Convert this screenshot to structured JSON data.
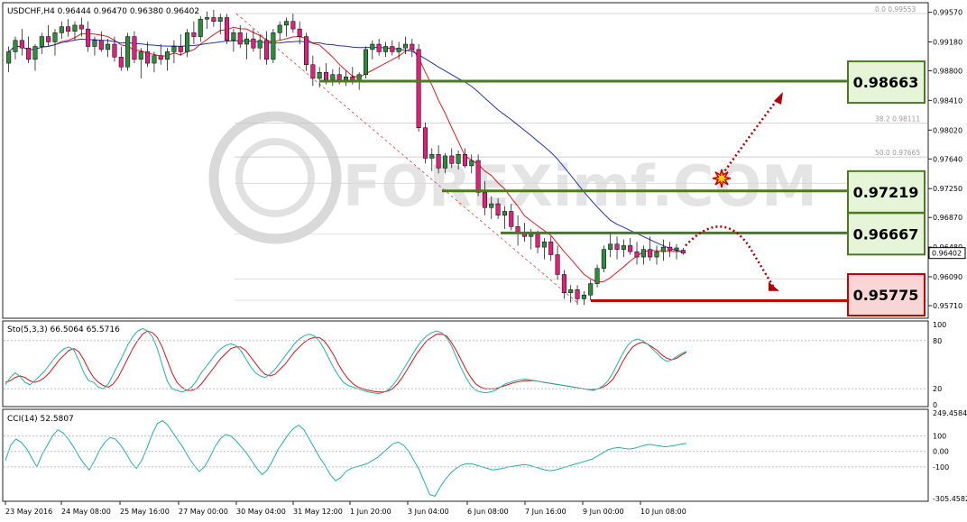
{
  "window": {
    "symbol_info": "USDCHF,H4  0.96444 0.96470 0.96380 0.96402"
  },
  "colors": {
    "bull": "#2e8b3a",
    "bear": "#e0207a",
    "ma_fast": "#e31c1c",
    "ma_slow": "#2233bb",
    "level_green": "#4a7c1f",
    "level_red": "#cc0000",
    "stoch_main": "#20b2aa",
    "stoch_signal": "#dd1111",
    "cci": "#20b2aa",
    "badge_green_bg": "#e6f4d7",
    "badge_red_bg": "#f9d6d6",
    "fib_text": "#9a9a9a"
  },
  "price_axis": {
    "ticks": [
      "0.99570",
      "0.99180",
      "0.98800",
      "0.98410",
      "0.98020",
      "0.97640",
      "0.97250",
      "0.96870",
      "0.96480",
      "0.96090",
      "0.95710"
    ],
    "current": "0.96402"
  },
  "fib_labels": [
    {
      "text": "0.0  0.99553",
      "price": 0.99553
    },
    {
      "text": "38.2  0.98111",
      "price": 0.98111
    },
    {
      "text": "50.0  0.97665",
      "price": 0.97665
    }
  ],
  "levels": [
    {
      "label": "0.98663",
      "price": 0.98663,
      "kind": "resistance"
    },
    {
      "label": "0.97219",
      "price": 0.97219,
      "kind": "resistance"
    },
    {
      "label": "0.96667",
      "price": 0.96667,
      "kind": "resistance"
    },
    {
      "label": "0.95775",
      "price": 0.95775,
      "kind": "support"
    }
  ],
  "watermark": "FOREXimf.COM",
  "stochastic": {
    "label": "Sto(5,3,3) 66.5064 65.5716",
    "ticks": [
      "100",
      "80",
      "20",
      "0"
    ],
    "main": [
      25,
      34,
      40,
      35,
      28,
      25,
      30,
      36,
      42,
      50,
      58,
      65,
      70,
      72,
      68,
      55,
      40,
      30,
      28,
      22,
      20,
      26,
      38,
      50,
      62,
      75,
      85,
      92,
      95,
      92,
      85,
      70,
      50,
      30,
      20,
      18,
      16,
      18,
      22,
      30,
      40,
      48,
      56,
      64,
      70,
      74,
      76,
      74,
      68,
      58,
      48,
      40,
      36,
      34,
      38,
      44,
      52,
      60,
      68,
      76,
      82,
      86,
      88,
      86,
      80,
      70,
      58,
      46,
      36,
      28,
      24,
      22,
      20,
      18,
      16,
      15,
      14,
      15,
      18,
      24,
      32,
      42,
      52,
      62,
      72,
      80,
      86,
      90,
      92,
      90,
      84,
      74,
      60,
      46,
      34,
      24,
      18,
      16,
      15,
      16,
      18,
      22,
      26,
      28,
      30,
      31,
      32,
      31,
      30,
      29,
      28,
      27,
      26,
      25,
      24,
      23,
      22,
      21,
      20,
      19,
      18,
      20,
      24,
      30,
      40,
      52,
      64,
      74,
      80,
      82,
      80,
      76,
      70,
      64,
      58,
      54,
      56,
      60,
      64,
      66.5
    ],
    "signal": [
      28,
      30,
      34,
      36,
      34,
      30,
      28,
      30,
      34,
      40,
      48,
      56,
      62,
      68,
      70,
      66,
      56,
      44,
      34,
      28,
      24,
      22,
      26,
      34,
      46,
      58,
      70,
      80,
      88,
      92,
      90,
      84,
      72,
      56,
      40,
      28,
      22,
      18,
      18,
      20,
      26,
      34,
      42,
      50,
      58,
      64,
      70,
      72,
      72,
      68,
      60,
      52,
      44,
      38,
      36,
      38,
      44,
      50,
      58,
      66,
      72,
      78,
      82,
      84,
      84,
      80,
      72,
      62,
      50,
      40,
      32,
      26,
      22,
      20,
      18,
      17,
      16,
      16,
      17,
      20,
      26,
      34,
      44,
      54,
      64,
      72,
      80,
      84,
      88,
      88,
      86,
      78,
      68,
      56,
      44,
      34,
      26,
      22,
      20,
      20,
      20,
      22,
      24,
      26,
      28,
      29,
      30,
      30,
      30,
      29,
      28,
      27,
      26,
      25,
      24,
      23,
      22,
      21,
      20,
      19,
      19,
      20,
      22,
      26,
      32,
      42,
      54,
      64,
      72,
      76,
      78,
      76,
      72,
      68,
      62,
      58,
      56,
      58,
      62,
      65.5
    ]
  },
  "cci": {
    "label": "CCI(14) 52.5807",
    "ticks": [
      "249.4584",
      "100",
      "0.00",
      "-100",
      "-305.4582"
    ],
    "values": [
      -60,
      40,
      80,
      60,
      20,
      -40,
      -100,
      -20,
      40,
      100,
      140,
      120,
      80,
      30,
      -30,
      -80,
      -120,
      -60,
      10,
      60,
      90,
      80,
      40,
      -10,
      -70,
      -110,
      -60,
      20,
      110,
      180,
      200,
      170,
      120,
      70,
      20,
      -40,
      -90,
      -130,
      -100,
      -40,
      30,
      80,
      110,
      100,
      70,
      30,
      -10,
      -60,
      -110,
      -150,
      -120,
      -60,
      10,
      60,
      110,
      150,
      170,
      140,
      80,
      20,
      -40,
      -90,
      -150,
      -190,
      -170,
      -130,
      -110,
      -100,
      -90,
      -80,
      -60,
      -40,
      -10,
      20,
      50,
      60,
      40,
      0,
      -60,
      -120,
      -200,
      -280,
      -290,
      -230,
      -180,
      -140,
      -110,
      -90,
      -80,
      -80,
      -90,
      -100,
      -110,
      -120,
      -115,
      -110,
      -100,
      -95,
      -90,
      -85,
      -90,
      -100,
      -110,
      -120,
      -125,
      -120,
      -110,
      -100,
      -90,
      -80,
      -70,
      -60,
      -50,
      -30,
      -10,
      10,
      20,
      25,
      20,
      15,
      20,
      30,
      40,
      45,
      40,
      35,
      30,
      35,
      40,
      48,
      52.6
    ]
  },
  "time_axis": [
    "23 May 2016",
    "24 May 08:00",
    "25 May 16:00",
    "27 May 00:00",
    "30 May 04:00",
    "31 May 12:00",
    "1 Jun 20:00",
    "3 Jun 04:00",
    "6 Jun 08:00",
    "7 Jun 16:00",
    "9 Jun 00:00",
    "10 Jun 08:00"
  ],
  "chart_data": {
    "type": "candlestick",
    "symbol": "USDCHF",
    "timeframe": "H4",
    "ylim": [
      0.9558,
      0.9966
    ],
    "candles": [
      {
        "o": 0.989,
        "h": 0.9912,
        "l": 0.9878,
        "c": 0.9905
      },
      {
        "o": 0.9905,
        "h": 0.9925,
        "l": 0.9895,
        "c": 0.992
      },
      {
        "o": 0.992,
        "h": 0.9935,
        "l": 0.99,
        "c": 0.991
      },
      {
        "o": 0.991,
        "h": 0.9925,
        "l": 0.989,
        "c": 0.9895
      },
      {
        "o": 0.9895,
        "h": 0.9915,
        "l": 0.988,
        "c": 0.9912
      },
      {
        "o": 0.9912,
        "h": 0.993,
        "l": 0.9902,
        "c": 0.9925
      },
      {
        "o": 0.9925,
        "h": 0.994,
        "l": 0.9912,
        "c": 0.9918
      },
      {
        "o": 0.9918,
        "h": 0.9935,
        "l": 0.99,
        "c": 0.993
      },
      {
        "o": 0.993,
        "h": 0.9945,
        "l": 0.9922,
        "c": 0.9938
      },
      {
        "o": 0.9938,
        "h": 0.9948,
        "l": 0.9925,
        "c": 0.9932
      },
      {
        "o": 0.9932,
        "h": 0.9945,
        "l": 0.992,
        "c": 0.994
      },
      {
        "o": 0.994,
        "h": 0.995,
        "l": 0.9925,
        "c": 0.9935
      },
      {
        "o": 0.9935,
        "h": 0.9945,
        "l": 0.9905,
        "c": 0.9912
      },
      {
        "o": 0.9912,
        "h": 0.9925,
        "l": 0.99,
        "c": 0.992
      },
      {
        "o": 0.992,
        "h": 0.9932,
        "l": 0.9905,
        "c": 0.9908
      },
      {
        "o": 0.9908,
        "h": 0.9922,
        "l": 0.9898,
        "c": 0.9915
      },
      {
        "o": 0.9915,
        "h": 0.9925,
        "l": 0.9892,
        "c": 0.9898
      },
      {
        "o": 0.9898,
        "h": 0.9912,
        "l": 0.988,
        "c": 0.9885
      },
      {
        "o": 0.9885,
        "h": 0.993,
        "l": 0.988,
        "c": 0.9925
      },
      {
        "o": 0.9925,
        "h": 0.9932,
        "l": 0.989,
        "c": 0.9895
      },
      {
        "o": 0.9895,
        "h": 0.991,
        "l": 0.987,
        "c": 0.9905
      },
      {
        "o": 0.9905,
        "h": 0.9918,
        "l": 0.9885,
        "c": 0.989
      },
      {
        "o": 0.989,
        "h": 0.9905,
        "l": 0.9878,
        "c": 0.99
      },
      {
        "o": 0.99,
        "h": 0.9915,
        "l": 0.9888,
        "c": 0.9895
      },
      {
        "o": 0.9895,
        "h": 0.991,
        "l": 0.988,
        "c": 0.9905
      },
      {
        "o": 0.9905,
        "h": 0.992,
        "l": 0.989,
        "c": 0.9912
      },
      {
        "o": 0.9912,
        "h": 0.9928,
        "l": 0.99,
        "c": 0.9905
      },
      {
        "o": 0.9905,
        "h": 0.9935,
        "l": 0.9898,
        "c": 0.993
      },
      {
        "o": 0.993,
        "h": 0.9945,
        "l": 0.9915,
        "c": 0.9925
      },
      {
        "o": 0.9925,
        "h": 0.9952,
        "l": 0.9918,
        "c": 0.9948
      },
      {
        "o": 0.9948,
        "h": 0.9958,
        "l": 0.9935,
        "c": 0.995
      },
      {
        "o": 0.995,
        "h": 0.996,
        "l": 0.9938,
        "c": 0.9945
      },
      {
        "o": 0.9945,
        "h": 0.9955,
        "l": 0.9928,
        "c": 0.995
      },
      {
        "o": 0.995,
        "h": 0.9955,
        "l": 0.9915,
        "c": 0.992
      },
      {
        "o": 0.992,
        "h": 0.9935,
        "l": 0.9905,
        "c": 0.993
      },
      {
        "o": 0.993,
        "h": 0.994,
        "l": 0.991,
        "c": 0.9915
      },
      {
        "o": 0.9915,
        "h": 0.993,
        "l": 0.9895,
        "c": 0.9922
      },
      {
        "o": 0.9922,
        "h": 0.9935,
        "l": 0.9905,
        "c": 0.991
      },
      {
        "o": 0.991,
        "h": 0.9928,
        "l": 0.9895,
        "c": 0.992
      },
      {
        "o": 0.992,
        "h": 0.9932,
        "l": 0.9888,
        "c": 0.9895
      },
      {
        "o": 0.9895,
        "h": 0.9935,
        "l": 0.989,
        "c": 0.993
      },
      {
        "o": 0.993,
        "h": 0.9945,
        "l": 0.992,
        "c": 0.994
      },
      {
        "o": 0.994,
        "h": 0.995,
        "l": 0.9925,
        "c": 0.9945
      },
      {
        "o": 0.9945,
        "h": 0.9955,
        "l": 0.993,
        "c": 0.9935
      },
      {
        "o": 0.9935,
        "h": 0.9945,
        "l": 0.9915,
        "c": 0.9925
      },
      {
        "o": 0.9925,
        "h": 0.993,
        "l": 0.988,
        "c": 0.9888
      },
      {
        "o": 0.9888,
        "h": 0.99,
        "l": 0.986,
        "c": 0.987
      },
      {
        "o": 0.987,
        "h": 0.9885,
        "l": 0.9858,
        "c": 0.9878
      },
      {
        "o": 0.9878,
        "h": 0.989,
        "l": 0.9862,
        "c": 0.9868
      },
      {
        "o": 0.9868,
        "h": 0.9882,
        "l": 0.986,
        "c": 0.9875
      },
      {
        "o": 0.9875,
        "h": 0.9885,
        "l": 0.9862,
        "c": 0.9868
      },
      {
        "o": 0.9868,
        "h": 0.988,
        "l": 0.986,
        "c": 0.9872
      },
      {
        "o": 0.9872,
        "h": 0.9885,
        "l": 0.9862,
        "c": 0.9865
      },
      {
        "o": 0.9865,
        "h": 0.9878,
        "l": 0.9855,
        "c": 0.9875
      },
      {
        "o": 0.9875,
        "h": 0.9912,
        "l": 0.987,
        "c": 0.9908
      },
      {
        "o": 0.9908,
        "h": 0.992,
        "l": 0.9895,
        "c": 0.9915
      },
      {
        "o": 0.9915,
        "h": 0.9922,
        "l": 0.99,
        "c": 0.9905
      },
      {
        "o": 0.9905,
        "h": 0.9918,
        "l": 0.9898,
        "c": 0.9912
      },
      {
        "o": 0.9912,
        "h": 0.992,
        "l": 0.99,
        "c": 0.9905
      },
      {
        "o": 0.9905,
        "h": 0.9918,
        "l": 0.9895,
        "c": 0.991
      },
      {
        "o": 0.991,
        "h": 0.9925,
        "l": 0.9902,
        "c": 0.9915
      },
      {
        "o": 0.9915,
        "h": 0.9922,
        "l": 0.9898,
        "c": 0.9908
      },
      {
        "o": 0.9908,
        "h": 0.9915,
        "l": 0.98,
        "c": 0.9805
      },
      {
        "o": 0.9805,
        "h": 0.9812,
        "l": 0.9758,
        "c": 0.9765
      },
      {
        "o": 0.9765,
        "h": 0.9778,
        "l": 0.9748,
        "c": 0.977
      },
      {
        "o": 0.977,
        "h": 0.9782,
        "l": 0.9745,
        "c": 0.9752
      },
      {
        "o": 0.9752,
        "h": 0.9772,
        "l": 0.9745,
        "c": 0.9768
      },
      {
        "o": 0.9768,
        "h": 0.9778,
        "l": 0.9752,
        "c": 0.9758
      },
      {
        "o": 0.9758,
        "h": 0.9775,
        "l": 0.975,
        "c": 0.977
      },
      {
        "o": 0.977,
        "h": 0.9778,
        "l": 0.9752,
        "c": 0.9755
      },
      {
        "o": 0.9755,
        "h": 0.977,
        "l": 0.9745,
        "c": 0.9762
      },
      {
        "o": 0.9762,
        "h": 0.977,
        "l": 0.9715,
        "c": 0.972
      },
      {
        "o": 0.972,
        "h": 0.9735,
        "l": 0.969,
        "c": 0.97
      },
      {
        "o": 0.97,
        "h": 0.9715,
        "l": 0.9685,
        "c": 0.9705
      },
      {
        "o": 0.9705,
        "h": 0.9712,
        "l": 0.9685,
        "c": 0.969
      },
      {
        "o": 0.969,
        "h": 0.9702,
        "l": 0.9672,
        "c": 0.9695
      },
      {
        "o": 0.9695,
        "h": 0.9705,
        "l": 0.967,
        "c": 0.9675
      },
      {
        "o": 0.9675,
        "h": 0.969,
        "l": 0.965,
        "c": 0.9668
      },
      {
        "o": 0.9668,
        "h": 0.968,
        "l": 0.9655,
        "c": 0.9662
      },
      {
        "o": 0.9662,
        "h": 0.9672,
        "l": 0.9645,
        "c": 0.9665
      },
      {
        "o": 0.9665,
        "h": 0.967,
        "l": 0.964,
        "c": 0.9648
      },
      {
        "o": 0.9648,
        "h": 0.966,
        "l": 0.9632,
        "c": 0.9655
      },
      {
        "o": 0.9655,
        "h": 0.9662,
        "l": 0.963,
        "c": 0.9638
      },
      {
        "o": 0.9638,
        "h": 0.965,
        "l": 0.9605,
        "c": 0.9612
      },
      {
        "o": 0.9612,
        "h": 0.9618,
        "l": 0.958,
        "c": 0.9588
      },
      {
        "o": 0.9588,
        "h": 0.9598,
        "l": 0.9575,
        "c": 0.9592
      },
      {
        "o": 0.9592,
        "h": 0.9598,
        "l": 0.9572,
        "c": 0.958
      },
      {
        "o": 0.958,
        "h": 0.959,
        "l": 0.9572,
        "c": 0.9585
      },
      {
        "o": 0.9585,
        "h": 0.9605,
        "l": 0.9578,
        "c": 0.96
      },
      {
        "o": 0.96,
        "h": 0.9625,
        "l": 0.9595,
        "c": 0.962
      },
      {
        "o": 0.962,
        "h": 0.965,
        "l": 0.9615,
        "c": 0.9645
      },
      {
        "o": 0.9645,
        "h": 0.9668,
        "l": 0.9635,
        "c": 0.9652
      },
      {
        "o": 0.9652,
        "h": 0.9662,
        "l": 0.9632,
        "c": 0.9645
      },
      {
        "o": 0.9645,
        "h": 0.9658,
        "l": 0.9635,
        "c": 0.965
      },
      {
        "o": 0.965,
        "h": 0.966,
        "l": 0.9638,
        "c": 0.9642
      },
      {
        "o": 0.9642,
        "h": 0.9655,
        "l": 0.9625,
        "c": 0.9635
      },
      {
        "o": 0.9635,
        "h": 0.965,
        "l": 0.9625,
        "c": 0.9645
      },
      {
        "o": 0.9645,
        "h": 0.9662,
        "l": 0.963,
        "c": 0.9635
      },
      {
        "o": 0.9635,
        "h": 0.965,
        "l": 0.9625,
        "c": 0.9642
      },
      {
        "o": 0.9642,
        "h": 0.9658,
        "l": 0.963,
        "c": 0.9648
      },
      {
        "o": 0.9648,
        "h": 0.9655,
        "l": 0.9635,
        "c": 0.9644
      },
      {
        "o": 0.9644,
        "h": 0.9652,
        "l": 0.9632,
        "c": 0.9647
      },
      {
        "o": 0.9644,
        "h": 0.9647,
        "l": 0.9638,
        "c": 0.964
      }
    ]
  }
}
